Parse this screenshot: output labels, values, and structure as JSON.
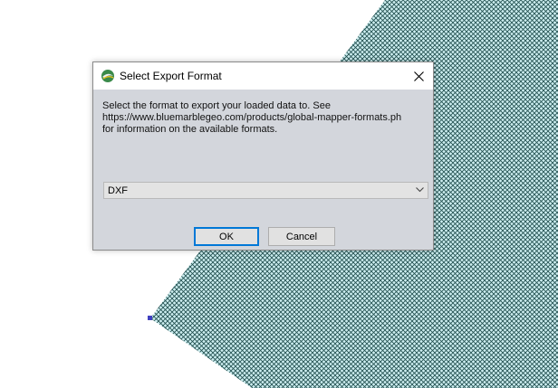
{
  "dialog": {
    "title": "Select Export Format",
    "message_lines": [
      "Select the format to export your loaded data to. See",
      "https://www.bluemarblegeo.com/products/global-mapper-formats.ph",
      "for information on the available formats."
    ],
    "selected_format": "DXF",
    "ok_label": "OK",
    "cancel_label": "Cancel"
  },
  "colors": {
    "hatch_fill": "#cdeef0",
    "hatch_lines": "#1e4c4c",
    "vertex_marker": "#4040c0",
    "focus_border": "#0078d7"
  },
  "icons": {
    "app_logo": "globe-logo-icon",
    "close": "close-icon",
    "dropdown": "chevron-down-icon"
  }
}
